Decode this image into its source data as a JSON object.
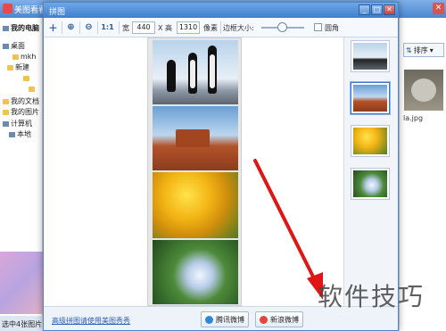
{
  "background": {
    "app_title": "美图看看",
    "sidebar": {
      "items": [
        {
          "label": "我的电脑"
        },
        {
          "label": "桌面"
        },
        {
          "label": "mkh"
        },
        {
          "label": "新建"
        },
        {
          "label": "我的文档"
        },
        {
          "label": "我的图片"
        },
        {
          "label": "计算机"
        },
        {
          "label": "本地"
        }
      ],
      "status": "选中4张图片"
    },
    "sort_label": "排序",
    "file_name": "la.jpg"
  },
  "dialog": {
    "title": "拼图",
    "toolbar": {
      "width_label": "宽",
      "width_value": "440",
      "x_label": "X 高",
      "height_value": "1310",
      "unit_label": "像素",
      "border_label": "边框大小:",
      "round_label": "圆角"
    },
    "photos": [
      {
        "name": "penguins"
      },
      {
        "name": "desert"
      },
      {
        "name": "tulips"
      },
      {
        "name": "hydrangea"
      }
    ],
    "footer": {
      "link_text": "高级拼图请使用美图秀秀",
      "tencent_label": "腾讯微博",
      "sina_label": "新浪微博"
    }
  },
  "watermark": "软件技巧",
  "colors": {
    "titlebar": "#4a86d0",
    "accent": "#3b78c8",
    "arrow": "#e01616"
  }
}
